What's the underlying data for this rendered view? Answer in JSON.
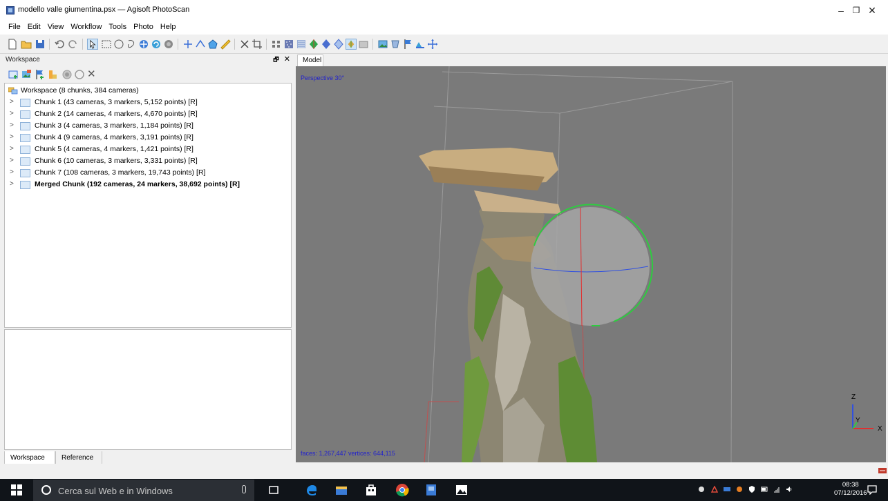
{
  "window": {
    "title": "modello valle giumentina.psx — Agisoft PhotoScan",
    "minimize": "–",
    "maximize": "❐",
    "close": "✕"
  },
  "menu": [
    "File",
    "Edit",
    "View",
    "Workflow",
    "Tools",
    "Photo",
    "Help"
  ],
  "workspace_panel": {
    "title": "Workspace",
    "float": "🗗",
    "close": "✕",
    "toolbar_close": "✕",
    "root": "Workspace (8 chunks, 384 cameras)",
    "chunks": [
      {
        "label": "Chunk 1 (43 cameras, 3 markers, 5,152 points) [R]",
        "bold": false
      },
      {
        "label": "Chunk 2 (14 cameras, 4 markers, 4,670 points) [R]",
        "bold": false
      },
      {
        "label": "Chunk 3 (4 cameras, 3 markers, 1,184 points) [R]",
        "bold": false
      },
      {
        "label": "Chunk 4 (9 cameras, 4 markers, 3,191 points) [R]",
        "bold": false
      },
      {
        "label": "Chunk 5 (4 cameras, 4 markers, 1,421 points) [R]",
        "bold": false
      },
      {
        "label": "Chunk 6 (10 cameras, 3 markers, 3,331 points) [R]",
        "bold": false
      },
      {
        "label": "Chunk 7 (108 cameras, 3 markers, 19,743 points) [R]",
        "bold": false
      },
      {
        "label": "Merged Chunk (192 cameras, 24 markers, 38,692 points) [R]",
        "bold": true
      }
    ],
    "tabs": [
      "Workspace",
      "Reference"
    ]
  },
  "model_view": {
    "tab": "Model",
    "projection": "Perspective 30°",
    "stats": "faces: 1,267,447 vertices: 644,115",
    "axes": {
      "z": "Z",
      "y": "Y",
      "x": "X"
    }
  },
  "taskbar": {
    "search_placeholder": "Cerca sul Web e in Windows",
    "time": "08:38",
    "date": "07/12/2016"
  },
  "colors": {
    "viewport_bg": "#7a7a7a",
    "gizmo_green": "#2ecc40",
    "gizmo_red": "#e03030",
    "gizmo_blue": "#3050e0",
    "label_blue": "#2222cc",
    "taskbar_bg": "#101419"
  }
}
